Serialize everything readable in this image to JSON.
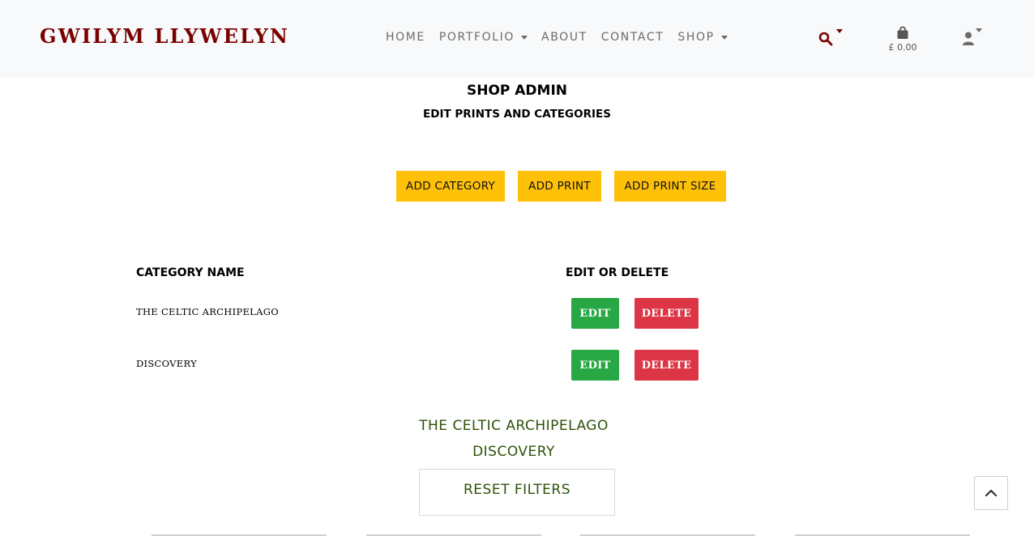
{
  "brand": {
    "name": "GWILYM LLYWELYN",
    "color": "#7a0000"
  },
  "nav": {
    "items": [
      {
        "label": "HOME",
        "dropdown": false
      },
      {
        "label": "PORTFOLIO",
        "dropdown": true
      },
      {
        "label": "ABOUT",
        "dropdown": false
      },
      {
        "label": "CONTACT",
        "dropdown": false
      },
      {
        "label": "SHOP",
        "dropdown": true
      }
    ],
    "search_icon": "search-icon",
    "bag": {
      "icon": "shopping-bag-icon",
      "total": "£ 0.00"
    },
    "user_icon": "user-icon"
  },
  "page": {
    "title": "SHOP ADMIN",
    "subtitle": "EDIT PRINTS AND CATEGORIES"
  },
  "actions": {
    "add_category": "ADD CATEGORY",
    "add_print": "ADD PRINT",
    "add_print_size": "ADD PRINT SIZE",
    "color": "#ffc107"
  },
  "table": {
    "headers": [
      "CATEGORY NAME",
      "EDIT OR DELETE"
    ],
    "rows": [
      {
        "name": "THE CELTIC ARCHIPELAGO",
        "edit": "EDIT",
        "delete": "DELETE"
      },
      {
        "name": "DISCOVERY",
        "edit": "EDIT",
        "delete": "DELETE"
      }
    ],
    "edit_color": "#28a745",
    "delete_color": "#dc3545"
  },
  "filters": {
    "items": [
      "THE CELTIC ARCHIPELAGO",
      "DISCOVERY"
    ],
    "reset_label": "RESET FILTERS",
    "color": "#2e5208"
  },
  "back_to_top_icon": "chevron-up-icon"
}
